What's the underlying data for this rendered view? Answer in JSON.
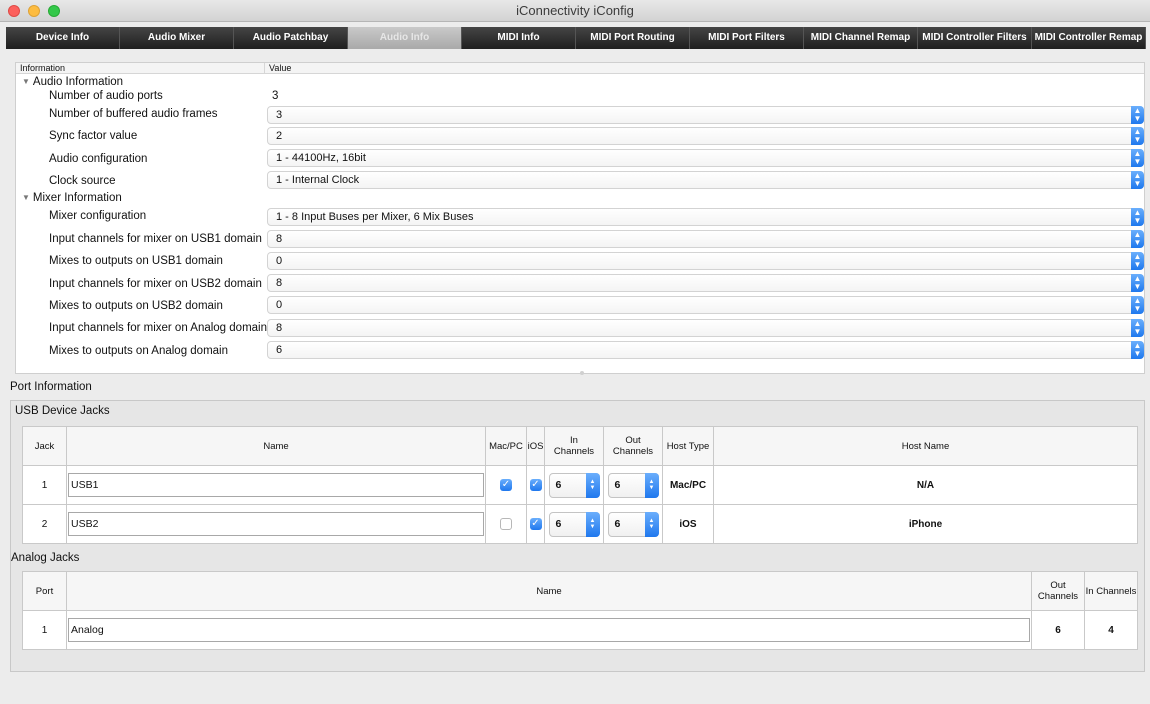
{
  "window": {
    "title": "iConnectivity iConfig"
  },
  "tabs": [
    {
      "label": "Device Info",
      "active": false
    },
    {
      "label": "Audio Mixer",
      "active": false
    },
    {
      "label": "Audio Patchbay",
      "active": false
    },
    {
      "label": "Audio Info",
      "active": true
    },
    {
      "label": "MIDI Info",
      "active": false
    },
    {
      "label": "MIDI Port Routing",
      "active": false
    },
    {
      "label": "MIDI Port Filters",
      "active": false
    },
    {
      "label": "MIDI Channel Remap",
      "active": false
    },
    {
      "label": "MIDI Controller Filters",
      "active": false
    },
    {
      "label": "MIDI Controller Remap",
      "active": false
    }
  ],
  "info_table": {
    "col_information": "Information",
    "col_value": "Value",
    "audio_section": "Audio Information",
    "num_audio_ports": {
      "label": "Number of audio ports",
      "value": "3"
    },
    "buffered_frames": {
      "label": "Number of buffered audio frames",
      "value": "3"
    },
    "sync_factor": {
      "label": "Sync factor value",
      "value": "2"
    },
    "audio_config": {
      "label": "Audio configuration",
      "value": "1 - 44100Hz, 16bit"
    },
    "clock_source": {
      "label": "Clock source",
      "value": "1 - Internal Clock"
    },
    "mixer_section": "Mixer Information",
    "mixer_config": {
      "label": "Mixer configuration",
      "value": "1 - 8 Input Buses per Mixer, 6 Mix Buses"
    },
    "in_usb1": {
      "label": "Input channels for mixer on USB1 domain",
      "value": "8"
    },
    "mix_usb1": {
      "label": "Mixes to outputs on USB1 domain",
      "value": "0"
    },
    "in_usb2": {
      "label": "Input channels for mixer on USB2 domain",
      "value": "8"
    },
    "mix_usb2": {
      "label": "Mixes to outputs on USB2 domain",
      "value": "0"
    },
    "in_analog": {
      "label": "Input channels for mixer on Analog domain",
      "value": "8"
    },
    "mix_analog": {
      "label": "Mixes to outputs on Analog domain",
      "value": "6"
    }
  },
  "port_info": {
    "title": "Port Information",
    "usb_title": "USB Device Jacks",
    "usb_headers": {
      "jack": "Jack",
      "name": "Name",
      "macpc": "Mac/PC",
      "ios": "iOS",
      "in_channels": "In Channels",
      "out_channels": "Out Channels",
      "host_type": "Host Type",
      "host_name": "Host Name"
    },
    "usb_rows": [
      {
        "jack": "1",
        "name": "USB1",
        "macpc": true,
        "ios": true,
        "in": "6",
        "out": "6",
        "host_type": "Mac/PC",
        "host_name": "N/A"
      },
      {
        "jack": "2",
        "name": "USB2",
        "macpc": false,
        "ios": true,
        "in": "6",
        "out": "6",
        "host_type": "iOS",
        "host_name": "iPhone"
      }
    ],
    "analog_title": "Analog Jacks",
    "analog_headers": {
      "port": "Port",
      "name": "Name",
      "out_channels": "Out Channels",
      "in_channels": "In Channels"
    },
    "analog_rows": [
      {
        "port": "1",
        "name": "Analog",
        "out": "6",
        "in": "4"
      }
    ]
  },
  "colors": {
    "accent": "#1f78ee",
    "tabbar": "#2b2b2b"
  }
}
